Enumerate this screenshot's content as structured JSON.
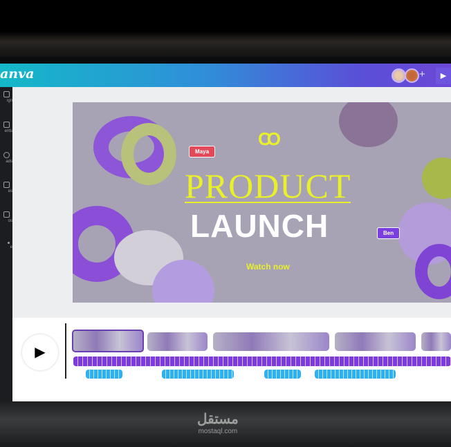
{
  "header": {
    "logo": "anva",
    "add_collaborator": "+",
    "present_icon": "play-icon"
  },
  "sidebar": {
    "items": [
      {
        "label": "ign"
      },
      {
        "label": "ents"
      },
      {
        "label": "ads"
      },
      {
        "label": "es"
      },
      {
        "label": "os"
      },
      {
        "label": "e"
      }
    ]
  },
  "design": {
    "logo": "CO",
    "title_line1": "PRODUCT",
    "title_line2": "LAUNCH",
    "cta": "Watch now",
    "cursor_maya": "Maya",
    "cursor_ben": "Ben"
  },
  "colors": {
    "accent_yellow": "#e9f02a",
    "audio_track": "#7c3adf",
    "voiceover": "#2fb0f0"
  },
  "timeline": {
    "play_icon": "play-icon"
  },
  "watermark": {
    "arabic": "مستقل",
    "latin": "mostaql.com"
  }
}
